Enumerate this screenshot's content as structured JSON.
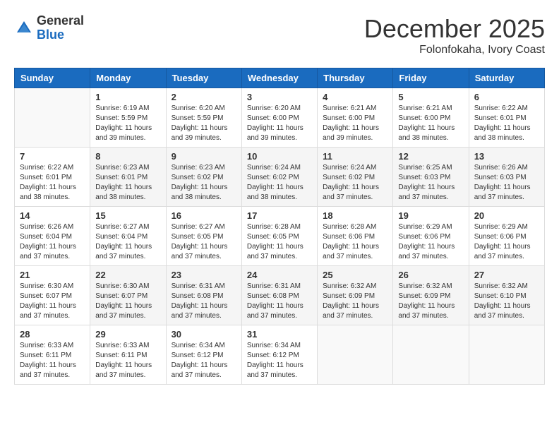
{
  "logo": {
    "general": "General",
    "blue": "Blue"
  },
  "title": {
    "month_year": "December 2025",
    "location": "Folonfokaha, Ivory Coast"
  },
  "headers": [
    "Sunday",
    "Monday",
    "Tuesday",
    "Wednesday",
    "Thursday",
    "Friday",
    "Saturday"
  ],
  "weeks": [
    [
      {
        "day": "",
        "info": ""
      },
      {
        "day": "1",
        "info": "Sunrise: 6:19 AM\nSunset: 5:59 PM\nDaylight: 11 hours\nand 39 minutes."
      },
      {
        "day": "2",
        "info": "Sunrise: 6:20 AM\nSunset: 5:59 PM\nDaylight: 11 hours\nand 39 minutes."
      },
      {
        "day": "3",
        "info": "Sunrise: 6:20 AM\nSunset: 6:00 PM\nDaylight: 11 hours\nand 39 minutes."
      },
      {
        "day": "4",
        "info": "Sunrise: 6:21 AM\nSunset: 6:00 PM\nDaylight: 11 hours\nand 39 minutes."
      },
      {
        "day": "5",
        "info": "Sunrise: 6:21 AM\nSunset: 6:00 PM\nDaylight: 11 hours\nand 38 minutes."
      },
      {
        "day": "6",
        "info": "Sunrise: 6:22 AM\nSunset: 6:01 PM\nDaylight: 11 hours\nand 38 minutes."
      }
    ],
    [
      {
        "day": "7",
        "info": "Sunrise: 6:22 AM\nSunset: 6:01 PM\nDaylight: 11 hours\nand 38 minutes."
      },
      {
        "day": "8",
        "info": "Sunrise: 6:23 AM\nSunset: 6:01 PM\nDaylight: 11 hours\nand 38 minutes."
      },
      {
        "day": "9",
        "info": "Sunrise: 6:23 AM\nSunset: 6:02 PM\nDaylight: 11 hours\nand 38 minutes."
      },
      {
        "day": "10",
        "info": "Sunrise: 6:24 AM\nSunset: 6:02 PM\nDaylight: 11 hours\nand 38 minutes."
      },
      {
        "day": "11",
        "info": "Sunrise: 6:24 AM\nSunset: 6:02 PM\nDaylight: 11 hours\nand 37 minutes."
      },
      {
        "day": "12",
        "info": "Sunrise: 6:25 AM\nSunset: 6:03 PM\nDaylight: 11 hours\nand 37 minutes."
      },
      {
        "day": "13",
        "info": "Sunrise: 6:26 AM\nSunset: 6:03 PM\nDaylight: 11 hours\nand 37 minutes."
      }
    ],
    [
      {
        "day": "14",
        "info": "Sunrise: 6:26 AM\nSunset: 6:04 PM\nDaylight: 11 hours\nand 37 minutes."
      },
      {
        "day": "15",
        "info": "Sunrise: 6:27 AM\nSunset: 6:04 PM\nDaylight: 11 hours\nand 37 minutes."
      },
      {
        "day": "16",
        "info": "Sunrise: 6:27 AM\nSunset: 6:05 PM\nDaylight: 11 hours\nand 37 minutes."
      },
      {
        "day": "17",
        "info": "Sunrise: 6:28 AM\nSunset: 6:05 PM\nDaylight: 11 hours\nand 37 minutes."
      },
      {
        "day": "18",
        "info": "Sunrise: 6:28 AM\nSunset: 6:06 PM\nDaylight: 11 hours\nand 37 minutes."
      },
      {
        "day": "19",
        "info": "Sunrise: 6:29 AM\nSunset: 6:06 PM\nDaylight: 11 hours\nand 37 minutes."
      },
      {
        "day": "20",
        "info": "Sunrise: 6:29 AM\nSunset: 6:06 PM\nDaylight: 11 hours\nand 37 minutes."
      }
    ],
    [
      {
        "day": "21",
        "info": "Sunrise: 6:30 AM\nSunset: 6:07 PM\nDaylight: 11 hours\nand 37 minutes."
      },
      {
        "day": "22",
        "info": "Sunrise: 6:30 AM\nSunset: 6:07 PM\nDaylight: 11 hours\nand 37 minutes."
      },
      {
        "day": "23",
        "info": "Sunrise: 6:31 AM\nSunset: 6:08 PM\nDaylight: 11 hours\nand 37 minutes."
      },
      {
        "day": "24",
        "info": "Sunrise: 6:31 AM\nSunset: 6:08 PM\nDaylight: 11 hours\nand 37 minutes."
      },
      {
        "day": "25",
        "info": "Sunrise: 6:32 AM\nSunset: 6:09 PM\nDaylight: 11 hours\nand 37 minutes."
      },
      {
        "day": "26",
        "info": "Sunrise: 6:32 AM\nSunset: 6:09 PM\nDaylight: 11 hours\nand 37 minutes."
      },
      {
        "day": "27",
        "info": "Sunrise: 6:32 AM\nSunset: 6:10 PM\nDaylight: 11 hours\nand 37 minutes."
      }
    ],
    [
      {
        "day": "28",
        "info": "Sunrise: 6:33 AM\nSunset: 6:11 PM\nDaylight: 11 hours\nand 37 minutes."
      },
      {
        "day": "29",
        "info": "Sunrise: 6:33 AM\nSunset: 6:11 PM\nDaylight: 11 hours\nand 37 minutes."
      },
      {
        "day": "30",
        "info": "Sunrise: 6:34 AM\nSunset: 6:12 PM\nDaylight: 11 hours\nand 37 minutes."
      },
      {
        "day": "31",
        "info": "Sunrise: 6:34 AM\nSunset: 6:12 PM\nDaylight: 11 hours\nand 37 minutes."
      },
      {
        "day": "",
        "info": ""
      },
      {
        "day": "",
        "info": ""
      },
      {
        "day": "",
        "info": ""
      }
    ]
  ]
}
